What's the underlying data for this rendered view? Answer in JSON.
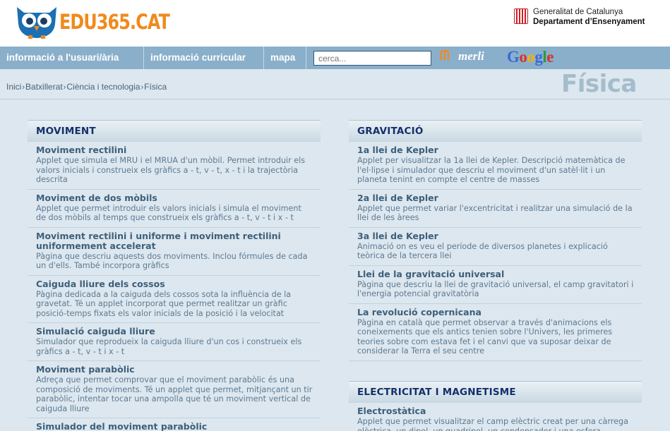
{
  "brand": {
    "logo_text": "EDU365.CAT",
    "gencat_line1": "Generalitat de Catalunya",
    "gencat_line2": "Departament d’Ensenyament"
  },
  "nav": {
    "items": [
      {
        "label": "informació a l'usuari/ària"
      },
      {
        "label": "informació curricular"
      },
      {
        "label": "mapa"
      }
    ],
    "search_placeholder": "cerca...",
    "merli_label": "merli",
    "google_label": "Google"
  },
  "breadcrumb": [
    "Inici",
    "Batxillerat",
    "Ciència i tecnologia",
    "Física"
  ],
  "page_title": "Física",
  "colors": {
    "nav_bg": "#8aafca",
    "page_bg": "#dde7ef",
    "title": "#a4bccb",
    "heading": "#13306b",
    "logo": "#f08a1c"
  },
  "sections": {
    "moviment": {
      "heading": "MOVIMENT",
      "entries": [
        {
          "title": "Moviment rectilini",
          "desc": "Applet que simula el MRU i el MRUA d'un mòbil. Permet introduir els valors inicials i construeix els gràfics a - t, v - t, x - t i la trajectòria descrita"
        },
        {
          "title": "Moviment de dos mòbils",
          "desc": "Applet que permet introduir els valors inicials i simula el moviment de dos mòbils al temps que construeix els gràfics a - t, v - t i x - t"
        },
        {
          "title": "Moviment rectilini i uniforme i moviment rectilini uniformement accelerat",
          "desc": "Pàgina que descriu aquests dos moviments. Inclou fórmules de cada un d'ells. També incorpora gràfics"
        },
        {
          "title": "Caiguda lliure dels cossos",
          "desc": "Pàgina dedicada a la caiguda dels cossos sota la influència de la gravetat. Té un applet incorporat que permet realitzar un gràfic posició-temps fixats els valor inicials de la posició i la velocitat"
        },
        {
          "title": "Simulació caiguda lliure",
          "desc": "Simulador que reprodueix la caiguda lliure d'un cos i construeix els gràfics a - t, v - t i x - t"
        },
        {
          "title": "Moviment parabòlic",
          "desc": "Adreça que permet comprovar que el moviment parabòlic és una composició de moviments. Té un applet que permet, mitjançant un tir parabòlic, intentar tocar una ampolla que té un moviment vertical de caiguda lliure"
        },
        {
          "title": "Simulador del moviment parabòlic",
          "desc": ""
        }
      ]
    },
    "gravitacio": {
      "heading": "GRAVITACIÓ",
      "entries": [
        {
          "title": "1a llei de Kepler",
          "desc": "Applet per visualitzar la 1a llei de Kepler. Descripció matemàtica de l'el·lipse i simulador que descriu el moviment d'un satèl·lit i un planeta tenint en compte el centre de masses"
        },
        {
          "title": "2a llei de Kepler",
          "desc": "Applet que permet variar l'excentricitat i realitzar una simulació de la llei de les àrees"
        },
        {
          "title": "3a llei de Kepler",
          "desc": "Animació on es veu el període de diversos planetes i explicació teòrica de la tercera llei"
        },
        {
          "title": "Llei de la gravitació universal",
          "desc": "Pàgina que descriu la llei de gravitació universal, el camp gravitatori i l'energia potencial gravitatòria"
        },
        {
          "title": "La revolució copernicana",
          "desc": "Pàgina en català que permet observar a través d'animacions els coneixements que els antics tenien sobre l'Univers, les primeres teories sobre com estava fet i el canvi que va suposar deixar de considerar la Terra el seu centre"
        }
      ]
    },
    "electricitat": {
      "heading": "ELECTRICITAT I MAGNETISME",
      "entries": [
        {
          "title": "Electrostàtica",
          "desc": "Applet que permet visualitzar el camp elèctric creat per una càrrega elèctrica, un dipol, un quadripol, un condensador i una esfera"
        }
      ]
    }
  }
}
